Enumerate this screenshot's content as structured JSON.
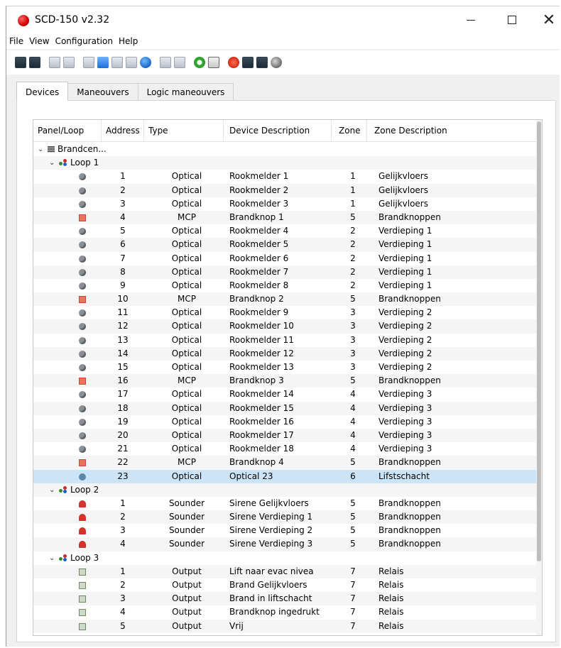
{
  "window": {
    "title": "SCD-150 v2.32"
  },
  "menu": [
    "File",
    "View",
    "Configuration",
    "Help"
  ],
  "toolbar_icons": [
    {
      "name": "open-icon",
      "style": "dark"
    },
    {
      "name": "save-icon",
      "style": "dark"
    },
    {
      "name": "sep"
    },
    {
      "name": "print-icon",
      "style": "light"
    },
    {
      "name": "print-preview-icon",
      "style": "light"
    },
    {
      "name": "sep"
    },
    {
      "name": "edit-icon",
      "style": "light"
    },
    {
      "name": "users-icon",
      "style": "blue"
    },
    {
      "name": "doc-icon",
      "style": "light"
    },
    {
      "name": "doc2-icon",
      "style": "light"
    },
    {
      "name": "globe-icon",
      "style": "round-blue"
    },
    {
      "name": "sep"
    },
    {
      "name": "report-icon",
      "style": "light"
    },
    {
      "name": "report-txt-icon",
      "style": "light"
    },
    {
      "name": "sep"
    },
    {
      "name": "refresh-icon",
      "style": "green"
    },
    {
      "name": "clipboard-icon",
      "style": "clip"
    },
    {
      "name": "sep"
    },
    {
      "name": "stop-icon",
      "style": "red"
    },
    {
      "name": "upload-icon",
      "style": "dark"
    },
    {
      "name": "download-icon",
      "style": "dark"
    },
    {
      "name": "search-icon",
      "style": "mag"
    }
  ],
  "tabs": [
    {
      "label": "Devices",
      "active": true
    },
    {
      "label": "Maneouvers",
      "active": false
    },
    {
      "label": "Logic maneouvers",
      "active": false
    }
  ],
  "columns": {
    "panel_loop": "Panel/Loop",
    "address": "Address",
    "type": "Type",
    "device_description": "Device Description",
    "zone": "Zone",
    "zone_description": "Zone Description"
  },
  "tree": {
    "panel": "Brandcen...",
    "loops": [
      {
        "name": "Loop 1",
        "devices": [
          {
            "addr": "1",
            "type": "Optical",
            "desc": "Rookmelder 1",
            "zone": "1",
            "zdesc": "Gelijkvloers"
          },
          {
            "addr": "2",
            "type": "Optical",
            "desc": "Rookmelder 2",
            "zone": "1",
            "zdesc": "Gelijkvloers"
          },
          {
            "addr": "3",
            "type": "Optical",
            "desc": "Rookmelder 3",
            "zone": "1",
            "zdesc": "Gelijkvloers"
          },
          {
            "addr": "4",
            "type": "MCP",
            "desc": "Brandknop 1",
            "zone": "5",
            "zdesc": "Brandknoppen"
          },
          {
            "addr": "5",
            "type": "Optical",
            "desc": "Rookmelder 4",
            "zone": "2",
            "zdesc": "Verdieping 1"
          },
          {
            "addr": "6",
            "type": "Optical",
            "desc": "Rookmelder 5",
            "zone": "2",
            "zdesc": "Verdieping 1"
          },
          {
            "addr": "7",
            "type": "Optical",
            "desc": "Rookmelder 6",
            "zone": "2",
            "zdesc": "Verdieping 1"
          },
          {
            "addr": "8",
            "type": "Optical",
            "desc": "Rookmelder 7",
            "zone": "2",
            "zdesc": "Verdieping 1"
          },
          {
            "addr": "9",
            "type": "Optical",
            "desc": "Rookmelder 8",
            "zone": "2",
            "zdesc": "Verdieping 1"
          },
          {
            "addr": "10",
            "type": "MCP",
            "desc": "Brandknop 2",
            "zone": "5",
            "zdesc": "Brandknoppen"
          },
          {
            "addr": "11",
            "type": "Optical",
            "desc": "Rookmelder 9",
            "zone": "3",
            "zdesc": "Verdieping 2"
          },
          {
            "addr": "12",
            "type": "Optical",
            "desc": "Rookmelder 10",
            "zone": "3",
            "zdesc": "Verdieping 2"
          },
          {
            "addr": "13",
            "type": "Optical",
            "desc": "Rookmelder 11",
            "zone": "3",
            "zdesc": "Verdieping 2"
          },
          {
            "addr": "14",
            "type": "Optical",
            "desc": "Rookmelder 12",
            "zone": "3",
            "zdesc": "Verdieping 2"
          },
          {
            "addr": "15",
            "type": "Optical",
            "desc": "Rookmelder 13",
            "zone": "3",
            "zdesc": "Verdieping 2"
          },
          {
            "addr": "16",
            "type": "MCP",
            "desc": "Brandknop 3",
            "zone": "5",
            "zdesc": "Brandknoppen"
          },
          {
            "addr": "17",
            "type": "Optical",
            "desc": "Rookmelder 14",
            "zone": "4",
            "zdesc": "Verdieping 3"
          },
          {
            "addr": "18",
            "type": "Optical",
            "desc": "Rookmelder 15",
            "zone": "4",
            "zdesc": "Verdieping 3"
          },
          {
            "addr": "19",
            "type": "Optical",
            "desc": "Rookmelder 16",
            "zone": "4",
            "zdesc": "Verdieping 3"
          },
          {
            "addr": "20",
            "type": "Optical",
            "desc": "Rookmelder 17",
            "zone": "4",
            "zdesc": "Verdieping 3"
          },
          {
            "addr": "21",
            "type": "Optical",
            "desc": "Rookmelder 18",
            "zone": "4",
            "zdesc": "Verdieping 3"
          },
          {
            "addr": "22",
            "type": "MCP",
            "desc": "Brandknop 4",
            "zone": "5",
            "zdesc": "Brandknoppen"
          },
          {
            "addr": "23",
            "type": "Optical",
            "desc": "Optical 23",
            "zone": "6",
            "zdesc": "Lifstschacht",
            "selected": true
          }
        ]
      },
      {
        "name": "Loop 2",
        "devices": [
          {
            "addr": "1",
            "type": "Sounder",
            "desc": "Sirene Gelijkvloers",
            "zone": "5",
            "zdesc": "Brandknoppen"
          },
          {
            "addr": "2",
            "type": "Sounder",
            "desc": "Sirene Verdieping 1",
            "zone": "5",
            "zdesc": "Brandknoppen"
          },
          {
            "addr": "3",
            "type": "Sounder",
            "desc": "Sirene Verdieping 2",
            "zone": "5",
            "zdesc": "Brandknoppen"
          },
          {
            "addr": "4",
            "type": "Sounder",
            "desc": "Sirene Verdieping 3",
            "zone": "5",
            "zdesc": "Brandknoppen"
          }
        ]
      },
      {
        "name": "Loop 3",
        "devices": [
          {
            "addr": "1",
            "type": "Output",
            "desc": "Lift naar evac nivea",
            "zone": "7",
            "zdesc": "Relais"
          },
          {
            "addr": "2",
            "type": "Output",
            "desc": "Brand Gelijkvloers",
            "zone": "7",
            "zdesc": "Relais"
          },
          {
            "addr": "3",
            "type": "Output",
            "desc": "Brand in liftschacht",
            "zone": "7",
            "zdesc": "Relais"
          },
          {
            "addr": "4",
            "type": "Output",
            "desc": "Brandknop ingedrukt",
            "zone": "7",
            "zdesc": "Relais"
          },
          {
            "addr": "5",
            "type": "Output",
            "desc": "Vrij",
            "zone": "7",
            "zdesc": "Relais"
          }
        ]
      }
    ]
  }
}
